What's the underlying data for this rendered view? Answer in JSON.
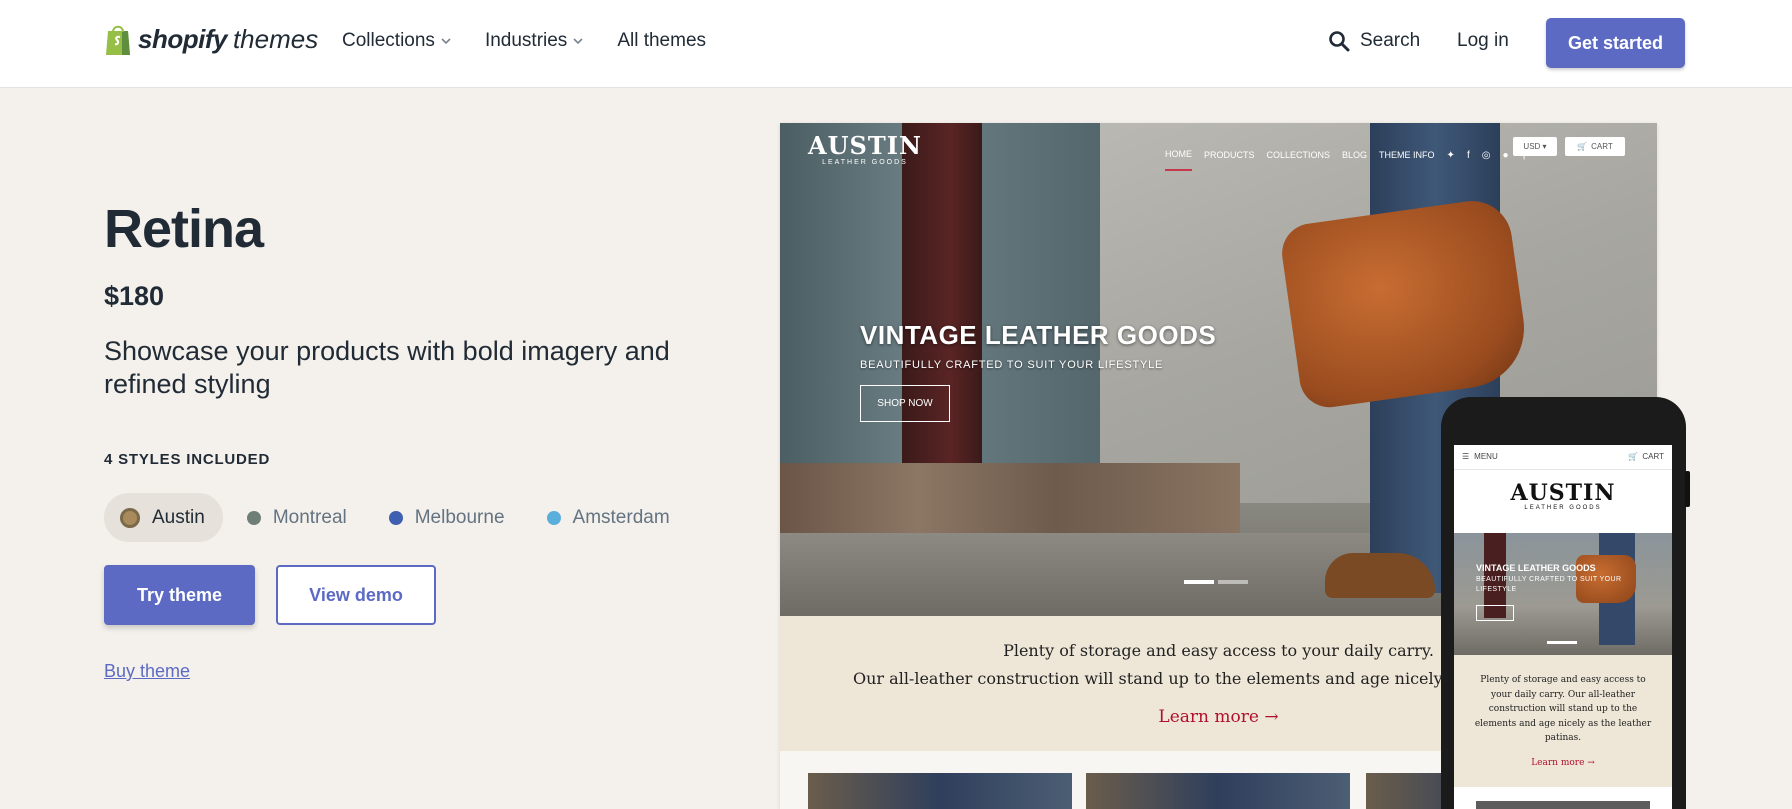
{
  "header": {
    "brand": "shopify",
    "brand_sub": "themes",
    "nav": [
      {
        "label": "Collections"
      },
      {
        "label": "Industries"
      },
      {
        "label": "All themes"
      }
    ],
    "search_label": "Search",
    "login_label": "Log in",
    "cta_label": "Get started"
  },
  "theme": {
    "name": "Retina",
    "price": "$180",
    "description": "Showcase your products with bold imagery and refined styling",
    "styles_label": "4 STYLES INCLUDED",
    "styles": [
      {
        "name": "Austin",
        "color": "#a88a5c",
        "active": true
      },
      {
        "name": "Montreal",
        "color": "#6f7f78",
        "active": false
      },
      {
        "name": "Melbourne",
        "color": "#3f5fb0",
        "active": false
      },
      {
        "name": "Amsterdam",
        "color": "#5aaedc",
        "active": false
      }
    ],
    "try_label": "Try theme",
    "demo_label": "View demo",
    "buy_label": "Buy theme"
  },
  "preview": {
    "store_name": "AUSTIN",
    "store_tagline": "LEATHER GOODS",
    "nav": [
      "HOME",
      "PRODUCTS",
      "COLLECTIONS",
      "BLOG",
      "THEME INFO"
    ],
    "currency": "USD",
    "cart_label": "CART",
    "hero_title": "VINTAGE LEATHER GOODS",
    "hero_subtitle": "BEAUTIFULLY CRAFTED TO SUIT YOUR LIFESTYLE",
    "hero_button": "SHOP NOW",
    "text_line1": "Plenty of storage and easy access to your daily carry.",
    "text_line2": "Our all-leather construction will stand up to the elements and age nicely as their leather patinas.",
    "learn_more": "Learn more →"
  },
  "mobile_preview": {
    "menu_label": "MENU",
    "cart_label": "CART",
    "store_name": "AUSTIN",
    "store_tagline": "LEATHER GOODS",
    "hero_title": "VINTAGE LEATHER GOODS",
    "hero_subtitle": "BEAUTIFULLY CRAFTED TO SUIT YOUR LIFESTYLE",
    "text": "Plenty of storage and easy access to your daily carry. Our all-leather construction will stand up to the elements and age nicely as the leather patinas.",
    "learn_more": "Learn more →"
  },
  "colors": {
    "accent": "#5c6ac4",
    "page_bg": "#f4f1ec",
    "learn_more": "#b0102d"
  }
}
